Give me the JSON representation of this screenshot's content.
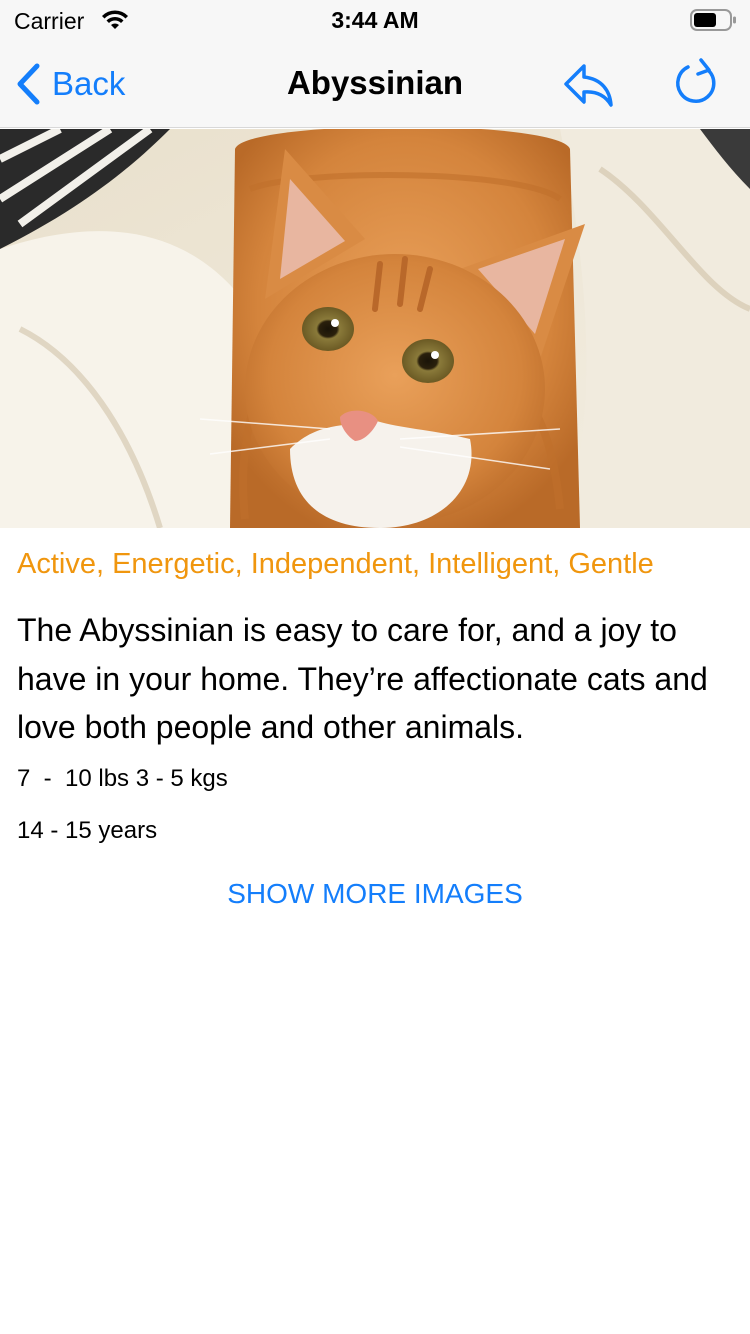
{
  "status_bar": {
    "carrier": "Carrier",
    "time": "3:44 AM",
    "wifi_icon": "wifi-icon",
    "battery_icon": "battery-icon"
  },
  "nav": {
    "back_label": "Back",
    "title": "Abyssinian",
    "back_icon": "chevron-back-icon",
    "share_icon": "reply-arrow-icon",
    "reload_icon": "reload-icon",
    "accent_color": "#147efb"
  },
  "hero": {
    "subject": "cat-photo"
  },
  "breed": {
    "temperament": "Active, Energetic, Independent, Intelligent, Gentle",
    "temperament_color": "#f0960e",
    "description": "The Abyssinian is easy to care for, and a joy to have in your home. They’re affectionate cats and love both people and other animals.",
    "weight": "7  -  10 lbs 3 - 5 kgs",
    "life_span": "14 - 15 years"
  },
  "actions": {
    "show_more_images": "SHOW MORE IMAGES"
  }
}
